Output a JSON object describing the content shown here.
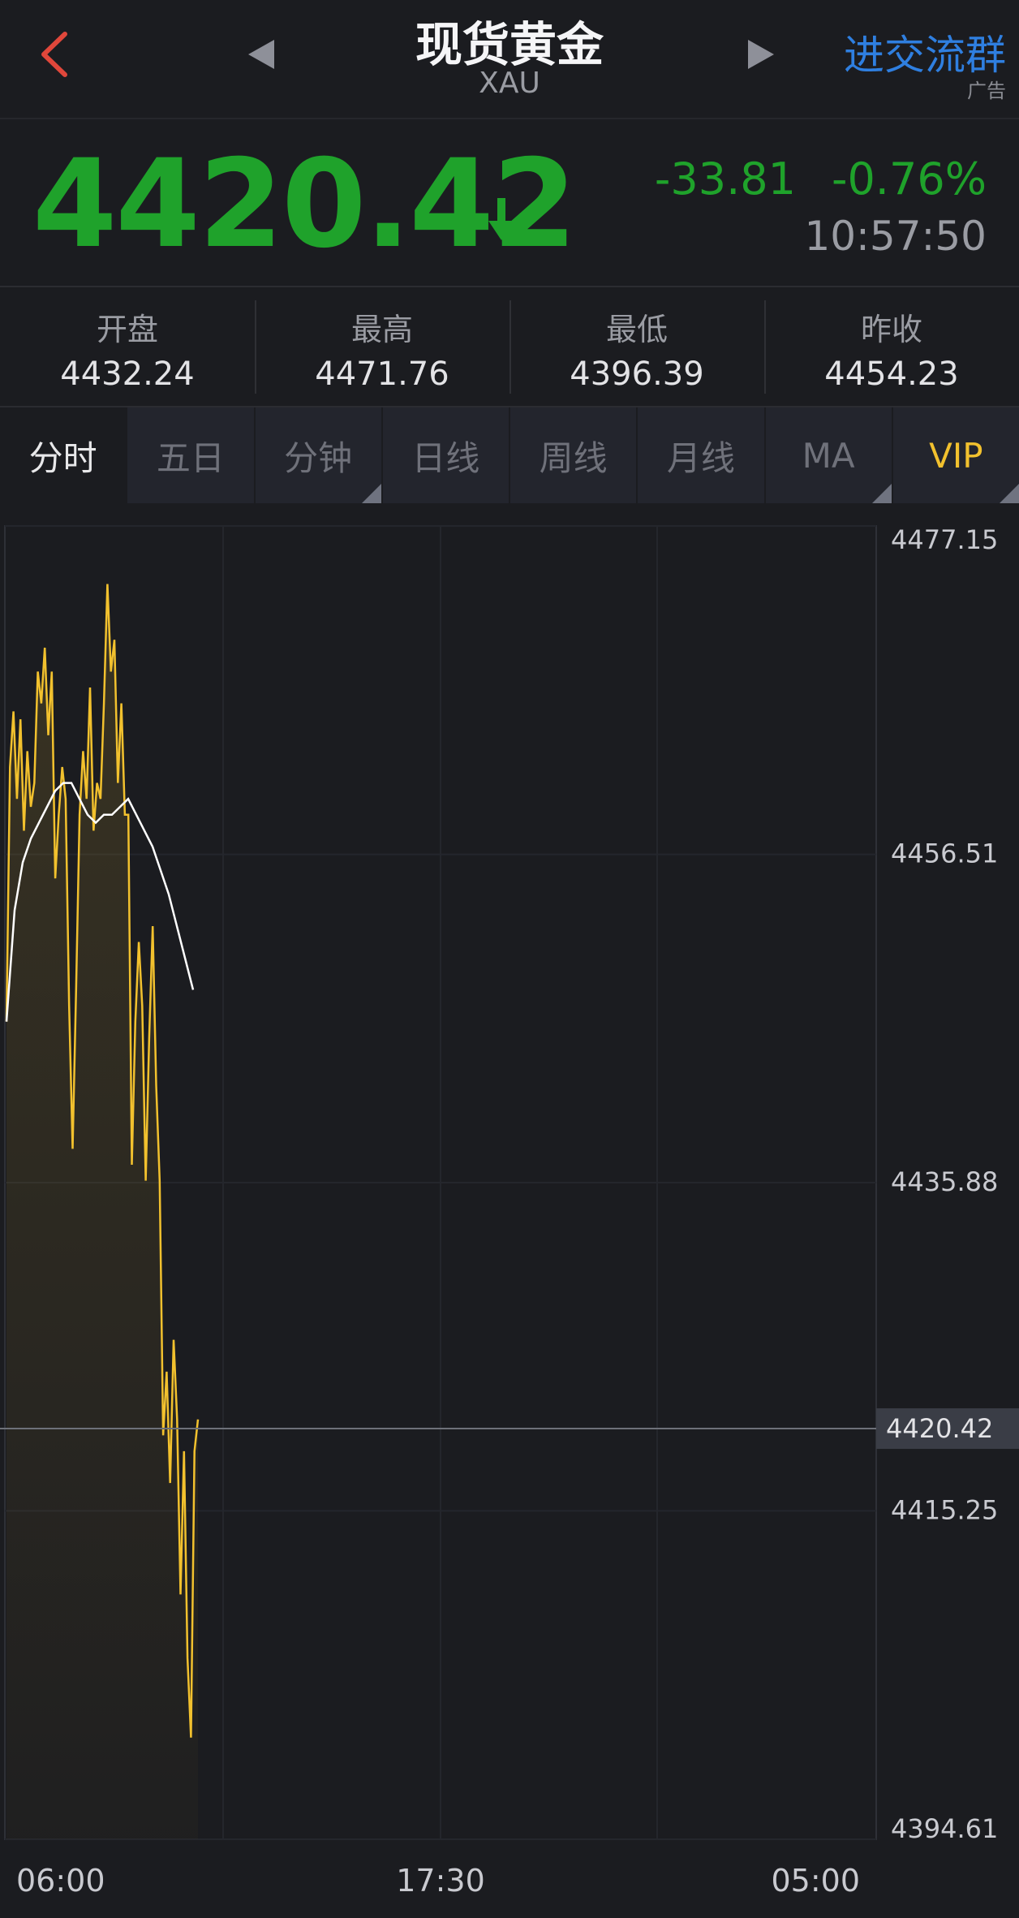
{
  "header": {
    "title": "现货黄金",
    "symbol": "XAU",
    "ad_link": "进交流群",
    "ad_tag": "广告"
  },
  "quote": {
    "price": "4420.42",
    "change": "-33.81",
    "change_pct": "-0.76%",
    "time": "10:57:50",
    "down_color": "#1fa22b"
  },
  "stats": [
    {
      "label": "开盘",
      "value": "4432.24"
    },
    {
      "label": "最高",
      "value": "4471.76"
    },
    {
      "label": "最低",
      "value": "4396.39"
    },
    {
      "label": "昨收",
      "value": "4454.23"
    }
  ],
  "tabs": [
    {
      "label": "分时",
      "active": true
    },
    {
      "label": "五日"
    },
    {
      "label": "分钟",
      "has_menu": true
    },
    {
      "label": "日线"
    },
    {
      "label": "周线"
    },
    {
      "label": "月线"
    },
    {
      "label": "MA",
      "has_menu": true
    },
    {
      "label": "VIP",
      "has_menu": true
    }
  ],
  "icons": {
    "back": "back-chevron-icon",
    "prev": "prev-arrow-icon",
    "next": "next-arrow-icon",
    "down": "down-arrow-icon"
  },
  "chart_data": {
    "type": "line",
    "y_ticks": [
      "4477.15",
      "4456.51",
      "4435.88",
      "4415.25",
      "4394.61"
    ],
    "ylim": [
      4394.61,
      4477.15
    ],
    "x_ticks": [
      "06:00",
      "17:30",
      "05:00"
    ],
    "current_price_label": "4420.42",
    "current_price": 4420.42,
    "series": [
      {
        "role": "price",
        "color": "#f2c12e",
        "values": [
          4446,
          4462,
          4465.5,
          4460,
          4465,
          4458,
          4463,
          4459.5,
          4461,
          4468,
          4466,
          4469.5,
          4464,
          4468,
          4455,
          4459,
          4462,
          4460,
          4447,
          4438,
          4448,
          4459,
          4463,
          4460,
          4467,
          4458,
          4461,
          4460,
          4466,
          4473.5,
          4468,
          4470,
          4461,
          4466,
          4459,
          4459,
          4437,
          4446,
          4451,
          4447,
          4436,
          4445,
          4452,
          4442,
          4436,
          4420,
          4424,
          4417,
          4426,
          4421,
          4410,
          4419,
          4406,
          4401,
          4419,
          4421
        ]
      },
      {
        "role": "average",
        "color": "#ffffff",
        "values": [
          4446,
          4453,
          4456,
          4457.5,
          4458.5,
          4459.5,
          4460.5,
          4461,
          4461,
          4460,
          4459,
          4458.5,
          4459,
          4459,
          4459.5,
          4460,
          4459,
          4458,
          4457,
          4455.5,
          4454,
          4452,
          4450,
          4448
        ]
      }
    ]
  }
}
